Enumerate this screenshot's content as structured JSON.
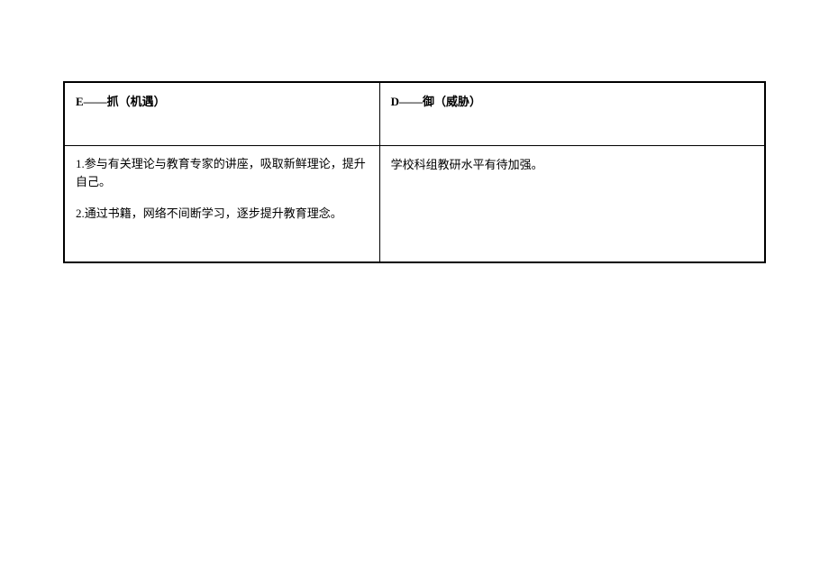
{
  "table": {
    "headers": {
      "left": "E——抓（机遇）",
      "right": "D——御（威胁）"
    },
    "content": {
      "left": {
        "line1": "1.参与有关理论与教育专家的讲座，吸取新鲜理论，提升自己。",
        "line2": "2.通过书籍，网络不间断学习，逐步提升教育理念。"
      },
      "right": "学校科组教研水平有待加强。"
    }
  }
}
